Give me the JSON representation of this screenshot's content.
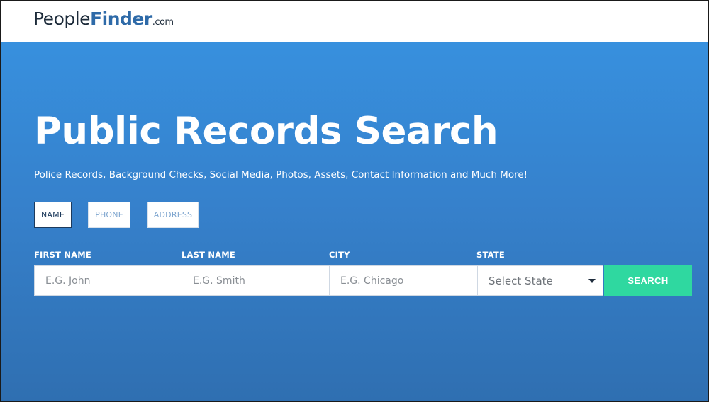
{
  "logo": {
    "people": "People",
    "finder": "Finder",
    "dotcom": ".com"
  },
  "hero": {
    "title": "Public Records Search",
    "subtitle": "Police Records, Background Checks, Social Media, Photos, Assets, Contact Information and Much More!"
  },
  "tabs": [
    {
      "label": "NAME",
      "active": true
    },
    {
      "label": "PHONE",
      "active": false
    },
    {
      "label": "ADDRESS",
      "active": false
    }
  ],
  "form": {
    "first_name": {
      "label": "FIRST NAME",
      "placeholder": "E.G. John",
      "value": ""
    },
    "last_name": {
      "label": "LAST NAME",
      "placeholder": "E.G. Smith",
      "value": ""
    },
    "city": {
      "label": "CITY",
      "placeholder": "E.G. Chicago",
      "value": ""
    },
    "state": {
      "label": "STATE",
      "selected": "Select State"
    },
    "search_label": "SEARCH"
  },
  "colors": {
    "brand_dark": "#1d2b3a",
    "brand_blue": "#2e6aa8",
    "hero_blue": "#3681cc",
    "search_green": "#2fd8a0"
  },
  "icons": {
    "state_dropdown": "caret-down-icon"
  }
}
